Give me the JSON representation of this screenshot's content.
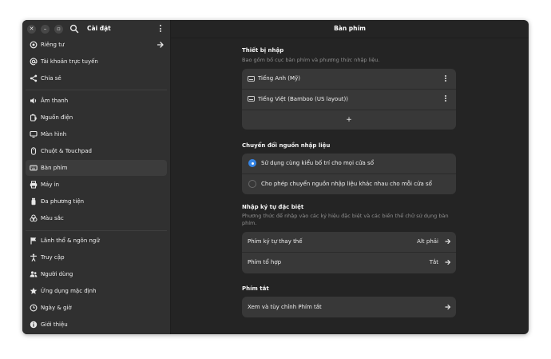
{
  "sidebar": {
    "title": "Cài đặt",
    "items": [
      {
        "label": "Riêng tư",
        "icon": "privacy-icon"
      },
      {
        "label": "Tài khoản trực tuyến",
        "icon": "at-sign-icon"
      },
      {
        "label": "Chia sẻ",
        "icon": "share-icon"
      },
      {
        "label": "Âm thanh",
        "icon": "speaker-icon"
      },
      {
        "label": "Nguồn điện",
        "icon": "power-icon"
      },
      {
        "label": "Màn hình",
        "icon": "display-icon"
      },
      {
        "label": "Chuột & Touchpad",
        "icon": "mouse-icon"
      },
      {
        "label": "Bàn phím",
        "icon": "keyboard-icon"
      },
      {
        "label": "Máy in",
        "icon": "printer-icon"
      },
      {
        "label": "Đa phương tiện",
        "icon": "media-icon"
      },
      {
        "label": "Màu sắc",
        "icon": "color-icon"
      },
      {
        "label": "Lãnh thổ & ngôn ngữ",
        "icon": "flag-icon"
      },
      {
        "label": "Truy cập",
        "icon": "accessibility-icon"
      },
      {
        "label": "Người dùng",
        "icon": "users-icon"
      },
      {
        "label": "Ứng dụng mặc định",
        "icon": "star-icon"
      },
      {
        "label": "Ngày & giờ",
        "icon": "clock-icon"
      },
      {
        "label": "Giới thiệu",
        "icon": "info-icon"
      }
    ]
  },
  "main": {
    "title": "Bàn phím",
    "input_devices": {
      "title": "Thiết bị nhập",
      "description": "Bao gồm bố cục bàn phím và phương thức nhập liệu.",
      "sources": [
        "Tiếng Anh (Mỹ)",
        "Tiếng Việt (Bamboo (US layout))"
      ],
      "add_label": "+"
    },
    "switching": {
      "title": "Chuyển đổi nguồn nhập liệu",
      "options": [
        {
          "label": "Sử dụng cùng kiểu bố trí cho mọi cửa sổ",
          "selected": true
        },
        {
          "label": "Cho phép chuyển nguồn nhập liệu khác nhau cho mỗi cửa sổ",
          "selected": false
        }
      ]
    },
    "special_chars": {
      "title": "Nhập ký tự đặc biệt",
      "description_line1": "Phương thức để nhập vào các ký hiệu đặc biệt và các biến thể chữ sử dụng bàn",
      "description_line2": "phím.",
      "rows": [
        {
          "label": "Phím ký tự thay thế",
          "value": "Alt phải"
        },
        {
          "label": "Phím tổ hợp",
          "value": "Tắt"
        }
      ]
    },
    "shortcuts": {
      "title": "Phím tắt",
      "row_label": "Xem và tùy chỉnh Phím tắt"
    }
  },
  "colors": {
    "window_bg": "#242424",
    "sidebar_bg": "#303030",
    "card_bg": "#383838",
    "accent": "#3584e4"
  }
}
